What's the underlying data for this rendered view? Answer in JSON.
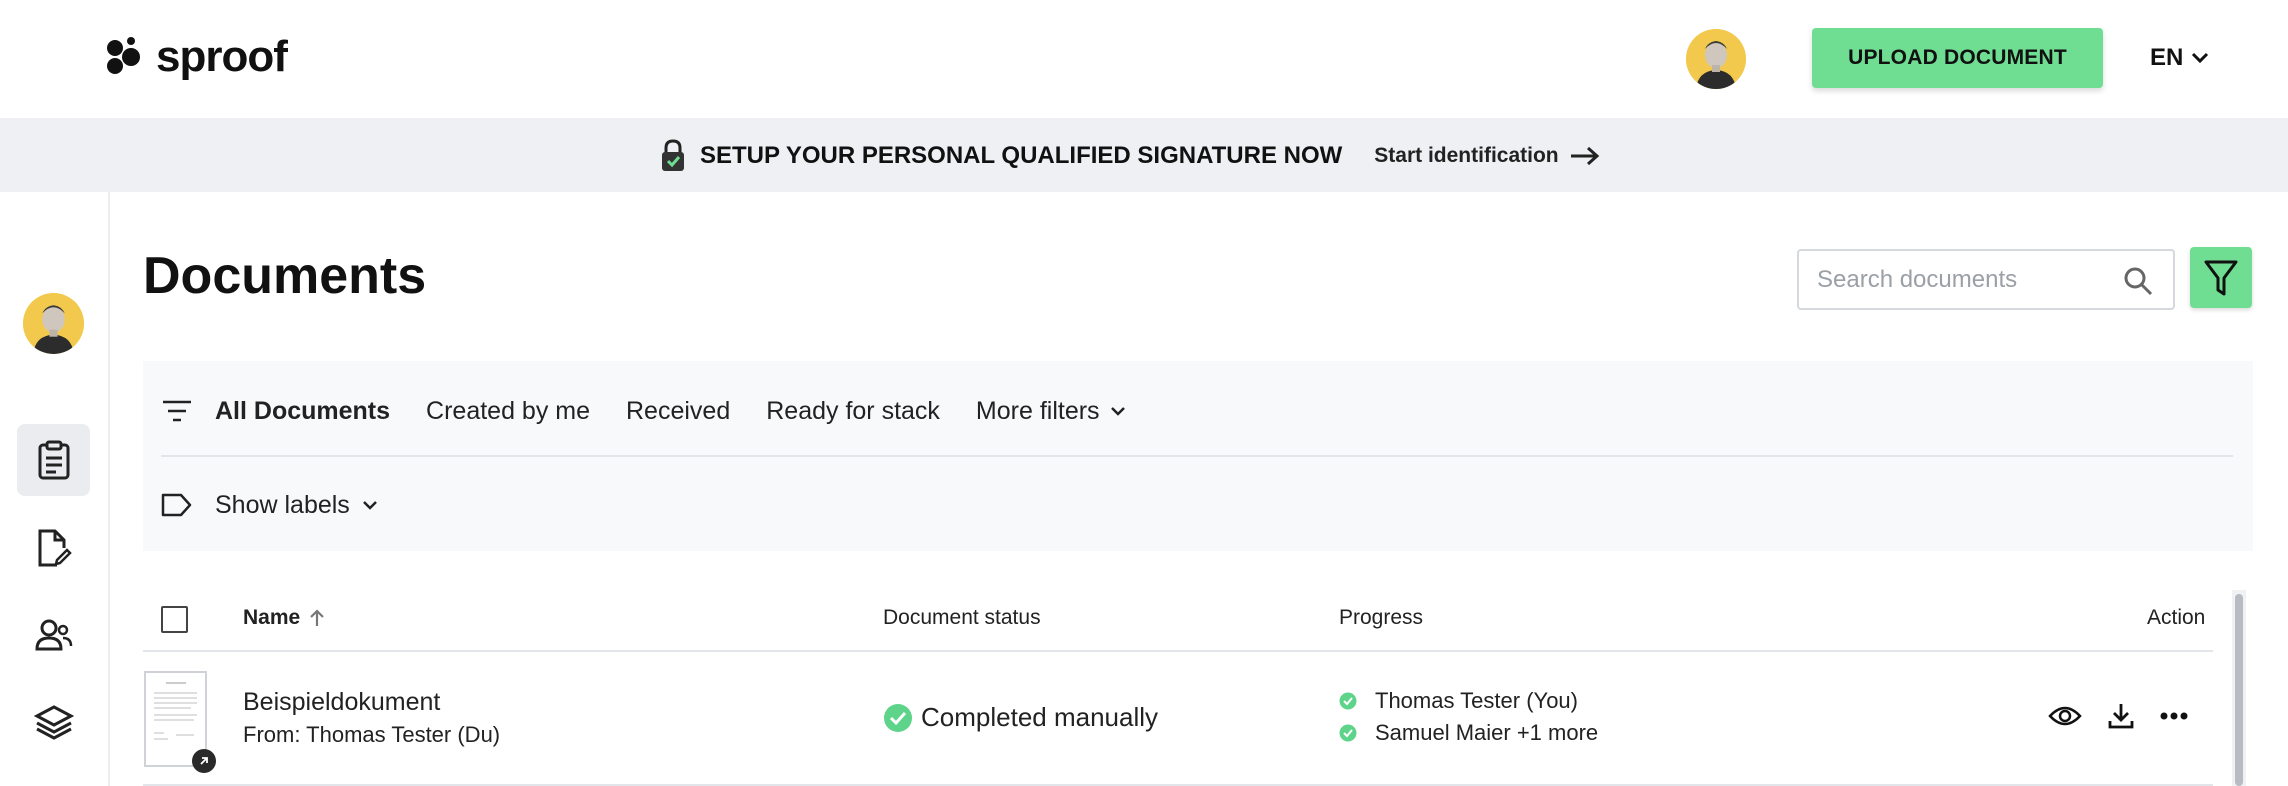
{
  "app": {
    "logo_text": "sproof"
  },
  "header": {
    "upload_label": "UPLOAD DOCUMENT",
    "language": "EN"
  },
  "banner": {
    "title": "SETUP YOUR PERSONAL QUALIFIED SIGNATURE NOW",
    "link_label": "Start identification"
  },
  "page": {
    "title": "Documents",
    "search_placeholder": "Search documents"
  },
  "filters": {
    "tabs": [
      {
        "label": "All Documents",
        "active": true
      },
      {
        "label": "Created by me",
        "active": false
      },
      {
        "label": "Received",
        "active": false
      },
      {
        "label": "Ready for stack",
        "active": false
      }
    ],
    "more_label": "More filters",
    "labels_label": "Show labels"
  },
  "table": {
    "columns": {
      "name": "Name",
      "status": "Document status",
      "progress": "Progress",
      "action": "Action"
    },
    "rows": [
      {
        "name": "Beispieldokument",
        "from": "From: Thomas Tester (Du)",
        "status": "Completed manually",
        "progress": [
          "Thomas Tester (You)",
          "Samuel Maier +1 more"
        ]
      }
    ]
  },
  "colors": {
    "accent": "#6fdd92",
    "banner_bg": "#eef0f3",
    "panel_bg": "#f8f9fb",
    "status_ok": "#5ed38a"
  },
  "icons": {
    "sidebar": [
      "clipboard-icon",
      "document-edit-icon",
      "contacts-icon",
      "layers-icon"
    ]
  }
}
